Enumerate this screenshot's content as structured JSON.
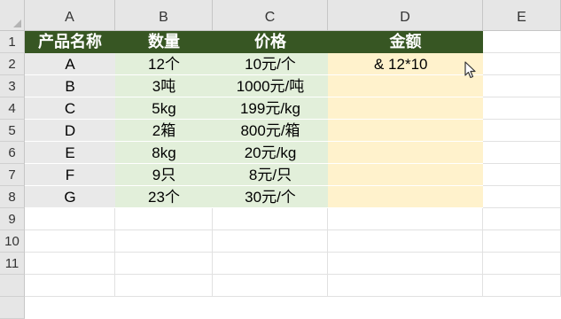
{
  "columns": [
    "A",
    "B",
    "C",
    "D",
    "E"
  ],
  "rows": [
    "1",
    "2",
    "3",
    "4",
    "5",
    "6",
    "7",
    "8",
    "9",
    "10",
    "11"
  ],
  "table": {
    "headers": [
      "产品名称",
      "数量",
      "价格",
      "金额"
    ],
    "rows": [
      [
        "A",
        "12个",
        "10元/个",
        "& 12*10"
      ],
      [
        "B",
        "3吨",
        "1000元/吨",
        ""
      ],
      [
        "C",
        "5kg",
        "199元/kg",
        ""
      ],
      [
        "D",
        "2箱",
        "800元/箱",
        ""
      ],
      [
        "E",
        "8kg",
        "20元/kg",
        ""
      ],
      [
        "F",
        "9只",
        "8元/只",
        ""
      ],
      [
        "G",
        "23个",
        "30元/个",
        ""
      ]
    ]
  },
  "colors": {
    "header_fill": "#375623",
    "col_a_fill": "#e9e9e9",
    "col_bc_fill": "#e2efda",
    "col_d_fill": "#fff2cc",
    "gridline": "#e1e1e1"
  },
  "cursor_icon": "mouse-pointer-icon"
}
